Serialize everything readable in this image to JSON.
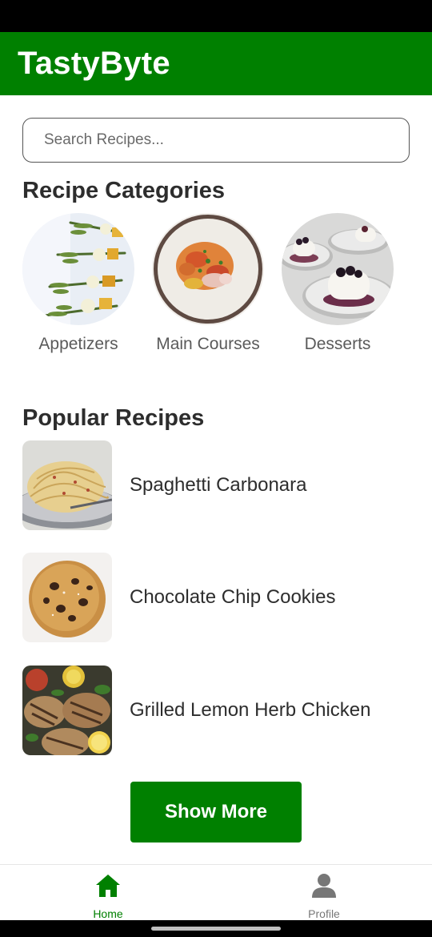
{
  "app": {
    "title": "TastyByte",
    "brand_color": "#008000"
  },
  "search": {
    "placeholder": "Search Recipes..."
  },
  "categories": {
    "title": "Recipe Categories",
    "items": [
      {
        "label": "Appetizers",
        "image": "appetizer-skewers-photo"
      },
      {
        "label": "Main Courses",
        "image": "main-course-plate-photo"
      },
      {
        "label": "Desserts",
        "image": "panna-cotta-dessert-photo"
      }
    ]
  },
  "popular": {
    "title": "Popular Recipes",
    "items": [
      {
        "name": "Spaghetti Carbonara",
        "image": "spaghetti-photo"
      },
      {
        "name": "Chocolate Chip Cookies",
        "image": "cookie-photo"
      },
      {
        "name": "Grilled Lemon Herb Chicken",
        "image": "grilled-chicken-photo"
      }
    ]
  },
  "actions": {
    "show_more_label": "Show More"
  },
  "bottom_nav": {
    "items": [
      {
        "label": "Home",
        "icon": "home-icon",
        "active": true
      },
      {
        "label": "Profile",
        "icon": "person-icon",
        "active": false
      }
    ]
  }
}
